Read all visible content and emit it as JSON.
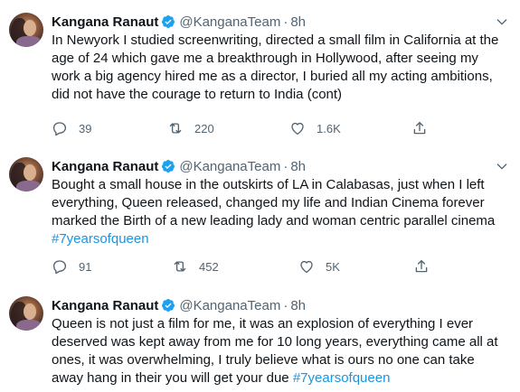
{
  "icons": {
    "verified": "verified-badge-icon",
    "more": "chevron-down-icon",
    "reply": "reply-icon",
    "retweet": "retweet-icon",
    "like": "heart-icon",
    "share": "share-icon"
  },
  "colors": {
    "text": "#0f1419",
    "secondary": "#536471",
    "link": "#1b95e0",
    "verified": "#1da1f2",
    "divider": "#e6ecf0"
  },
  "tweets": [
    {
      "author": {
        "name": "Kangana Ranaut",
        "handle": "@KanganaTeam",
        "separator": "·",
        "time": "8h"
      },
      "text": "In Newyork I studied screenwriting, directed a small film in California at the age of 24 which gave me a breakthrough in Hollywood, after seeing my work a big agency hired me as a director, I buried all my acting ambitions, did not have the courage to return to India (cont)",
      "hashtag": "",
      "stats": {
        "replies": "39",
        "retweets": "220",
        "likes": "1.6K"
      }
    },
    {
      "author": {
        "name": "Kangana Ranaut",
        "handle": "@KanganaTeam",
        "separator": "·",
        "time": "8h"
      },
      "text": "Bought a small house in the outskirts of LA in Calabasas, just when I left everything, Queen released, changed my life and Indian Cinema forever marked the Birth of a new leading lady and woman centric parallel cinema",
      "hashtag": "#7yearsofqueen",
      "stats": {
        "replies": "91",
        "retweets": "452",
        "likes": "5K"
      }
    },
    {
      "author": {
        "name": "Kangana Ranaut",
        "handle": "@KanganaTeam",
        "separator": "·",
        "time": "8h"
      },
      "text": "Queen is not just a film for me, it was an explosion of everything I ever deserved was kept away from me for 10 long years, everything came all at ones, it was overwhelming, I truly believe what is ours no one can take away hang in their you will get your due ",
      "hashtag": "#7yearsofqueen",
      "stats": {
        "replies": "",
        "retweets": "",
        "likes": ""
      }
    }
  ]
}
